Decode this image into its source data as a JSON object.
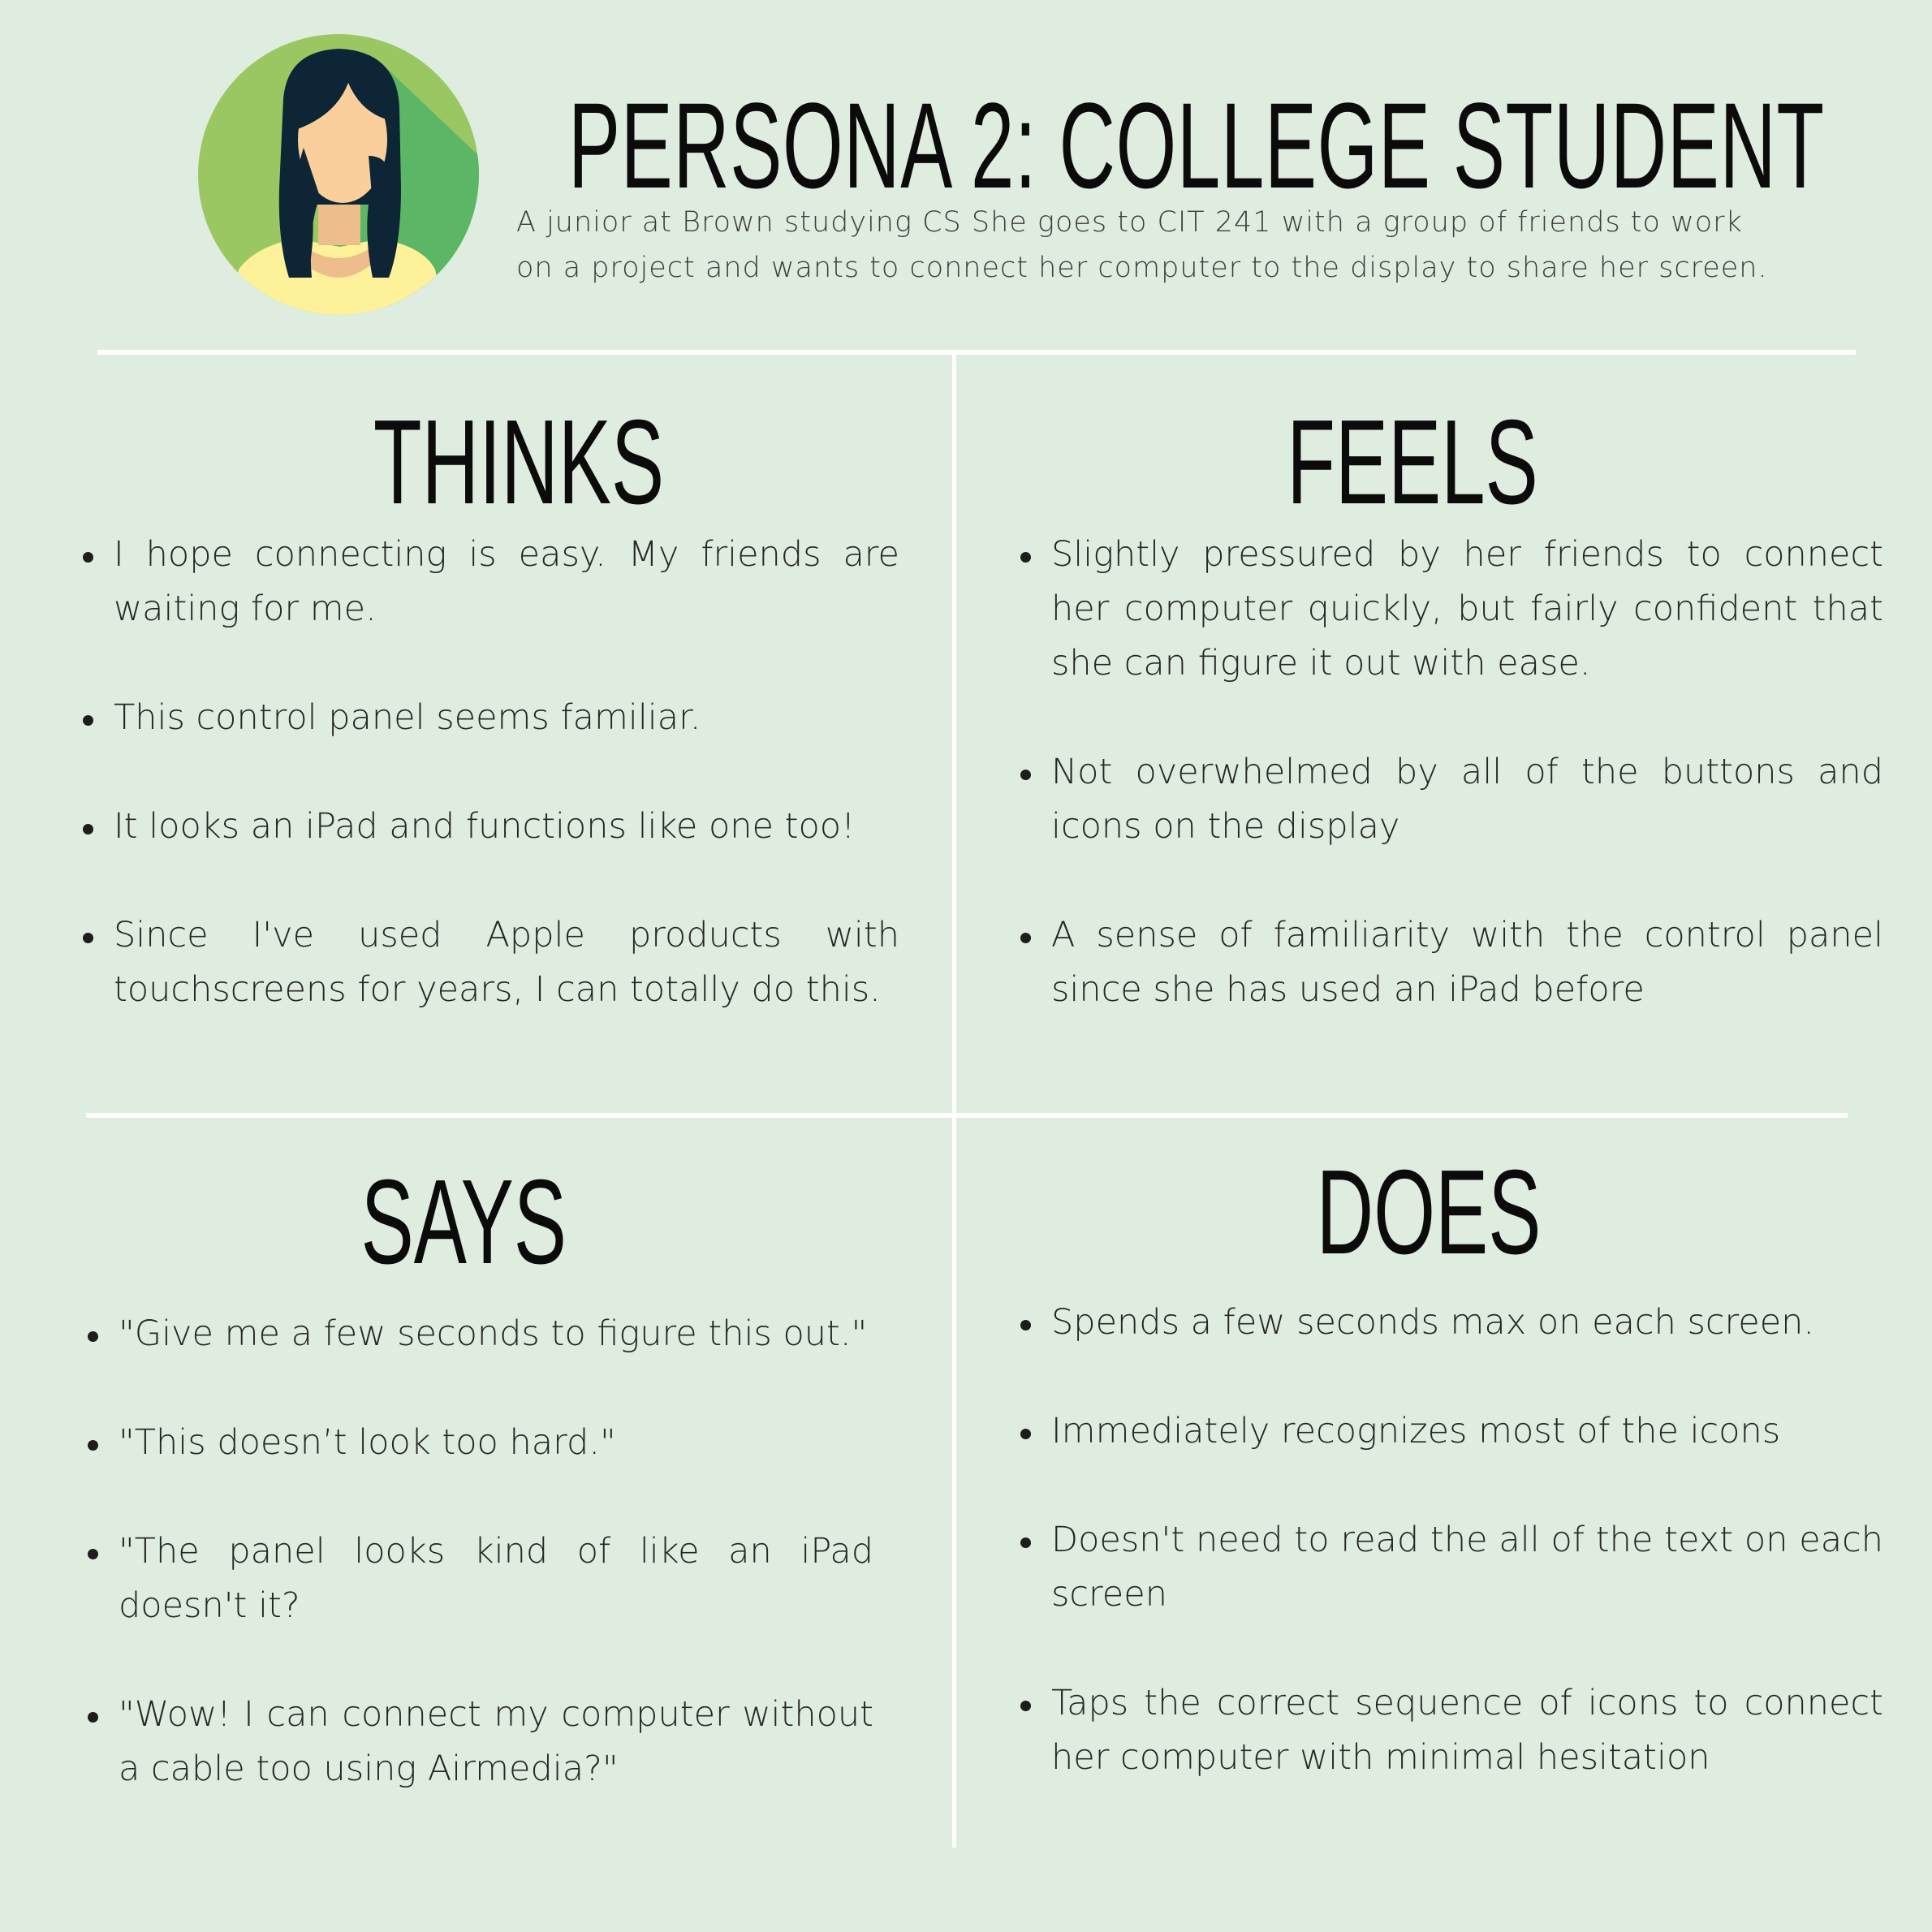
{
  "header": {
    "title": "PERSONA 2: COLLEGE STUDENT",
    "description": "A junior at Brown studying CS She goes to CIT 241 with a group of friends to work on a project and wants to connect her computer to the display to share her screen.",
    "avatar_icon": "female-student-avatar-icon"
  },
  "colors": {
    "background": "#deede0",
    "divider": "#ffffff",
    "avatar_circle": "#9bc763",
    "avatar_shadow": "#5bb766",
    "hair": "#0d2535",
    "skin": "#fbcf9c",
    "shirt": "#fdf19a"
  },
  "quadrants": {
    "thinks": {
      "heading": "THINKS",
      "items": [
        "I hope connecting is easy. My friends are waiting for me.",
        "This control panel seems familiar.",
        "It looks an iPad and functions like one too!",
        "Since I've used Apple products with touchscreens for years, I can totally do this."
      ]
    },
    "feels": {
      "heading": "FEELS",
      "items": [
        "Slightly pressured by her friends to connect her computer quickly, but fairly confident that she can figure it out with ease.",
        "Not overwhelmed by all of the buttons and icons on the display",
        " A sense of familiarity with the control panel since she has used an iPad before"
      ]
    },
    "says": {
      "heading": "SAYS",
      "items": [
        "\"Give me a few seconds to figure this out.\"",
        "\"This doesn’t look too hard.\"",
        "\"The panel looks kind of like an iPad doesn't it?",
        " \"Wow! I can connect my computer without a cable too using Airmedia?\""
      ]
    },
    "does": {
      "heading": "DOES",
      "items": [
        "Spends a few seconds max on each screen.",
        "Immediately recognizes most of the icons",
        "Doesn't need to read the all of the text on each screen",
        "Taps the correct sequence of icons to connect her computer with minimal hesitation"
      ]
    }
  }
}
